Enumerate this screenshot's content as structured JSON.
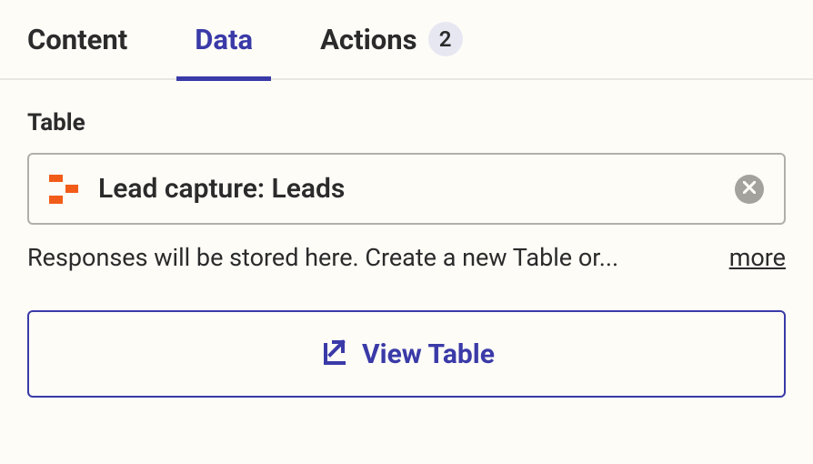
{
  "tabs": {
    "content": {
      "label": "Content"
    },
    "data": {
      "label": "Data"
    },
    "actions": {
      "label": "Actions",
      "badge": "2"
    }
  },
  "section": {
    "label": "Table",
    "table_name": "Lead capture: Leads",
    "help_text": "Responses will be stored here. Create a new Table or...",
    "more_label": "more",
    "view_button": "View Table"
  },
  "colors": {
    "accent": "#3a3aa8",
    "icon_orange": "#f25c19"
  }
}
